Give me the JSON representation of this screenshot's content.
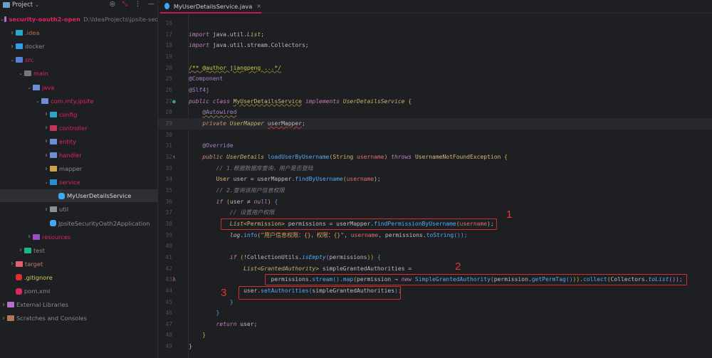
{
  "sidebar": {
    "title": "Project",
    "tools": [
      "target-icon",
      "collapse-icon",
      "more-icon",
      "minimize-icon"
    ],
    "items": [
      {
        "label": "security-oauth2-open",
        "path": "D:\\IdeaProjects\\jpsite-sec",
        "level": 0,
        "state": "open",
        "color": "#e0245e",
        "icon": "#b76fd0",
        "bold": true
      },
      {
        "label": ".idea",
        "level": 1,
        "state": "closed",
        "color": "#b8734f",
        "icon": "#2aa6c9"
      },
      {
        "label": "docker",
        "level": 1,
        "state": "closed",
        "color": "#8a8a8a",
        "icon": "#2ea0e6"
      },
      {
        "label": "src",
        "level": 1,
        "state": "open",
        "color": "#e0245e",
        "icon": "#5b7fd6"
      },
      {
        "label": "main",
        "level": 2,
        "state": "open",
        "color": "#e0245e",
        "icon": "#777777"
      },
      {
        "label": "java",
        "level": 3,
        "state": "open",
        "color": "#e0245e",
        "icon": "#6d8fd6"
      },
      {
        "label": "com.mty.jpsite",
        "level": 4,
        "state": "open",
        "color": "#e0245e",
        "icon": "#6d8fd6"
      },
      {
        "label": "config",
        "level": 5,
        "state": "closed",
        "color": "#e0245e",
        "icon": "#2aa6c9"
      },
      {
        "label": "controller",
        "level": 5,
        "state": "closed",
        "color": "#e0245e",
        "icon": "#c0365a"
      },
      {
        "label": "entity",
        "level": 5,
        "state": "closed",
        "color": "#e0245e",
        "icon": "#6d8fd6"
      },
      {
        "label": "handler",
        "level": 5,
        "state": "closed",
        "color": "#e0245e",
        "icon": "#6d8fd6"
      },
      {
        "label": "mapper",
        "level": 5,
        "state": "closed",
        "color": "#8a8a8a",
        "icon": "#c9a54a"
      },
      {
        "label": "service",
        "level": 5,
        "state": "open",
        "color": "#e0245e",
        "icon": "#2a8fd0"
      },
      {
        "label": "MyUserDetailsService",
        "level": 6,
        "state": "leaf",
        "color": "#d8d8d8",
        "icon": "#3fa9f5",
        "selected": true
      },
      {
        "label": "util",
        "level": 5,
        "state": "closed",
        "color": "#8a8a8a",
        "icon": "#8a8f99"
      },
      {
        "label": "JpsiteSecurityOath2Application",
        "level": 5,
        "state": "leaf",
        "color": "#8a8a8a",
        "icon": "#3fa9f5"
      },
      {
        "label": "resources",
        "level": 3,
        "state": "closed",
        "color": "#e0245e",
        "icon": "#9b4fc7"
      },
      {
        "label": "test",
        "level": 2,
        "state": "closed",
        "color": "#8a8a8a",
        "icon": "#1bb58a"
      },
      {
        "label": "target",
        "level": 1,
        "state": "closed",
        "color": "#c77a7a",
        "icon": "#e06070"
      },
      {
        "label": ".gitignore",
        "level": 1,
        "state": "leaf",
        "color": "#d6c95a",
        "icon": "#e0302a"
      },
      {
        "label": "pom.xml",
        "level": 1,
        "state": "leaf",
        "color": "#8a8a8a",
        "icon": "#e0245e"
      },
      {
        "label": "External Libraries",
        "level": 0,
        "state": "closed",
        "color": "#8a8a8a",
        "icon": "#b76fd0"
      },
      {
        "label": "Scratches and Consoles",
        "level": 0,
        "state": "closed",
        "color": "#8a8a8a",
        "icon": "#b07a5a"
      }
    ]
  },
  "tab": {
    "label": "MyUserDetailsService.java",
    "close": "×"
  },
  "editor": {
    "current_line": 29,
    "lines": [
      {
        "n": 16,
        "t": []
      },
      {
        "n": 17,
        "t": [
          [
            "import",
            "kw"
          ],
          [
            " java.util.",
            "id"
          ],
          [
            "List",
            "ty st"
          ],
          [
            ";",
            "pu"
          ]
        ]
      },
      {
        "n": 18,
        "t": [
          [
            "import",
            "kw"
          ],
          [
            " java.util.stream.Collectors",
            "id"
          ],
          [
            ";",
            "pu"
          ]
        ]
      },
      {
        "n": 19,
        "t": []
      },
      {
        "n": 20,
        "t": [
          [
            "/** @author jiangpeng ...*/",
            "doc"
          ]
        ]
      },
      {
        "n": 25,
        "t": [
          [
            "@Component",
            "an2"
          ]
        ]
      },
      {
        "n": 26,
        "t": [
          [
            "@Slf4j",
            "an2"
          ]
        ]
      },
      {
        "n": 27,
        "g": "bean-icon",
        "t": [
          [
            "public class ",
            "kw"
          ],
          [
            "MyUserDetailsService",
            "ty2 ul"
          ],
          [
            " implements ",
            "kw"
          ],
          [
            "UserDetailsService",
            "ty"
          ],
          [
            " {",
            "br"
          ]
        ]
      },
      {
        "n": 28,
        "t": [
          [
            "    ",
            " "
          ],
          [
            "@Autowired",
            "an2 ul"
          ]
        ]
      },
      {
        "n": 29,
        "t": [
          [
            "    ",
            " "
          ],
          [
            "private ",
            "kw2"
          ],
          [
            "UserMapper",
            "ty"
          ],
          [
            " ",
            "id"
          ],
          [
            "userMapper",
            "id err"
          ],
          [
            ";",
            "pu"
          ]
        ]
      },
      {
        "n": 30,
        "t": []
      },
      {
        "n": 31,
        "t": [
          [
            "    ",
            " "
          ],
          [
            "@Override",
            "an2"
          ]
        ]
      },
      {
        "n": 32,
        "g": "override-icon",
        "t": [
          [
            "    ",
            " "
          ],
          [
            "public ",
            "kw2"
          ],
          [
            "UserDetails",
            "ty"
          ],
          [
            " ",
            "id"
          ],
          [
            "loadUserByUsername",
            "fn"
          ],
          [
            "(",
            "br"
          ],
          [
            "String ",
            "ty2"
          ],
          [
            "username",
            "par"
          ],
          [
            ") ",
            "br"
          ],
          [
            "throws ",
            "kw"
          ],
          [
            "UsernameNotFoundException",
            "ty2"
          ],
          [
            " {",
            "br"
          ]
        ]
      },
      {
        "n": 33,
        "t": [
          [
            "        ",
            " "
          ],
          [
            "// 1.根据数据库查询，用户是否登陆",
            "cm"
          ]
        ]
      },
      {
        "n": 34,
        "t": [
          [
            "        ",
            " "
          ],
          [
            "User",
            "ty2"
          ],
          [
            " user = userMapper.",
            "id"
          ],
          [
            "findByUsername",
            "fn"
          ],
          [
            "(",
            "br"
          ],
          [
            "username",
            "par"
          ],
          [
            ");",
            "pu"
          ]
        ]
      },
      {
        "n": 35,
        "t": [
          [
            "        ",
            " "
          ],
          [
            "// 2.查询该用户信息权限",
            "cm"
          ]
        ]
      },
      {
        "n": 36,
        "t": [
          [
            "        ",
            " "
          ],
          [
            "if ",
            "kw"
          ],
          [
            "(",
            "br"
          ],
          [
            "user ≠ ",
            "id"
          ],
          [
            "null",
            "kw"
          ],
          [
            ") ",
            "br"
          ],
          [
            "{",
            "br3"
          ]
        ]
      },
      {
        "n": 37,
        "t": [
          [
            "            ",
            " "
          ],
          [
            "// 设置用户权限",
            "cm"
          ]
        ]
      },
      {
        "n": 38,
        "t": [
          [
            "            ",
            " "
          ],
          [
            "List",
            "ty"
          ],
          [
            "<",
            "br"
          ],
          [
            "Permission",
            "ty2"
          ],
          [
            "> ",
            "br"
          ],
          [
            "permissions = userMapper.",
            "id"
          ],
          [
            "findPermissionByUsername",
            "fn"
          ],
          [
            "(",
            "br"
          ],
          [
            "username",
            "par"
          ],
          [
            ");",
            "pu"
          ]
        ]
      },
      {
        "n": 39,
        "t": [
          [
            "            ",
            " "
          ],
          [
            "log",
            "id st"
          ],
          [
            ".",
            "id"
          ],
          [
            "info",
            "fn"
          ],
          [
            "(",
            "br"
          ],
          [
            "\"用户信息权限：{}，权限：{}\"",
            "str"
          ],
          [
            ", ",
            "pu"
          ],
          [
            "username",
            "par"
          ],
          [
            ", permissions.",
            "id"
          ],
          [
            "toString",
            "fn"
          ],
          [
            "());",
            "br3"
          ]
        ]
      },
      {
        "n": 40,
        "t": []
      },
      {
        "n": 41,
        "t": [
          [
            "            ",
            " "
          ],
          [
            "if ",
            "kw"
          ],
          [
            "(",
            "br"
          ],
          [
            "!CollectionUtils.",
            "id"
          ],
          [
            "isEmpty",
            "fn st"
          ],
          [
            "(",
            "br2"
          ],
          [
            "permissions",
            "id"
          ],
          [
            "))",
            "br"
          ],
          [
            " {",
            "br3"
          ]
        ]
      },
      {
        "n": 42,
        "t": [
          [
            "                ",
            " "
          ],
          [
            "List",
            "ty"
          ],
          [
            "<",
            "br"
          ],
          [
            "GrantedAuthority",
            "ty"
          ],
          [
            "> ",
            "br"
          ],
          [
            "simpleGrantedAuthorities =",
            "id"
          ]
        ]
      },
      {
        "n": 43,
        "g": "lambda-icon",
        "t": [
          [
            "                        ",
            " "
          ],
          [
            "permissions.",
            "id"
          ],
          [
            "stream",
            "fn"
          ],
          [
            "().",
            "br3"
          ],
          [
            "map",
            "fn"
          ],
          [
            "(",
            "br"
          ],
          [
            "permission → ",
            "id"
          ],
          [
            "new ",
            "kw"
          ],
          [
            "SimpleGrantedAuthority",
            "fn"
          ],
          [
            "(",
            "br2"
          ],
          [
            "permission.",
            "id"
          ],
          [
            "getPermTag",
            "fn"
          ],
          [
            "()",
            "br3"
          ],
          [
            ")).",
            "br"
          ],
          [
            "collect",
            "fn"
          ],
          [
            "(",
            "br"
          ],
          [
            "Collectors.",
            "id"
          ],
          [
            "toList",
            "fn st"
          ],
          [
            "());",
            "br2"
          ]
        ]
      },
      {
        "n": 44,
        "t": [
          [
            "                ",
            " "
          ],
          [
            "user.",
            "id"
          ],
          [
            "setAuthorities",
            "fn"
          ],
          [
            "(",
            "br3"
          ],
          [
            "simpleGrantedAuthorities",
            "id"
          ],
          [
            ");",
            "br3"
          ]
        ]
      },
      {
        "n": 45,
        "t": [
          [
            "            ",
            " "
          ],
          [
            "}",
            "br3"
          ]
        ]
      },
      {
        "n": 46,
        "t": [
          [
            "        ",
            " "
          ],
          [
            "}",
            "br3"
          ]
        ]
      },
      {
        "n": 47,
        "t": [
          [
            "        ",
            " "
          ],
          [
            "return ",
            "kw"
          ],
          [
            "user;",
            "id"
          ]
        ]
      },
      {
        "n": 48,
        "t": [
          [
            "    ",
            " "
          ],
          [
            "}",
            "br"
          ]
        ]
      },
      {
        "n": 49,
        "t": [
          [
            "}",
            "id"
          ]
        ]
      }
    ]
  },
  "annotations": [
    {
      "label": "1",
      "line": 38
    },
    {
      "label": "2",
      "line": 43
    },
    {
      "label": "3",
      "line": 44
    }
  ]
}
